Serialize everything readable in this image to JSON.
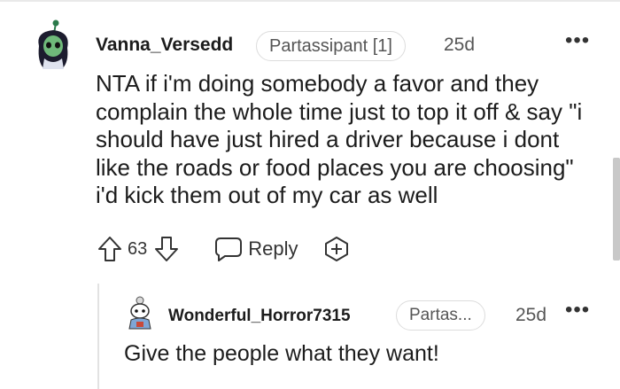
{
  "comment": {
    "username": "Vanna_Versedd",
    "flair": "Partassipant [1]",
    "timestamp": "25d",
    "more_label": "•••",
    "body": "NTA if i'm doing somebody a favor and they complain the whole time just to top it off & say \"i should have just hired a driver because i dont like the roads or food places you are choosing\" i'd kick them out of my car as well",
    "score": "63",
    "reply_label": "Reply"
  },
  "reply": {
    "username": "Wonderful_Horror7315",
    "flair": "Partas...",
    "timestamp": "25d",
    "more_label": "•••",
    "body": "Give the people what they want!"
  },
  "icons": {
    "upvote": "arrow-up-outline",
    "downvote": "arrow-down-outline",
    "reply": "speech-bubble",
    "award": "plus-in-circle"
  },
  "colors": {
    "text": "#1c1c1c",
    "muted": "#555555",
    "border": "#dcdcdc"
  }
}
